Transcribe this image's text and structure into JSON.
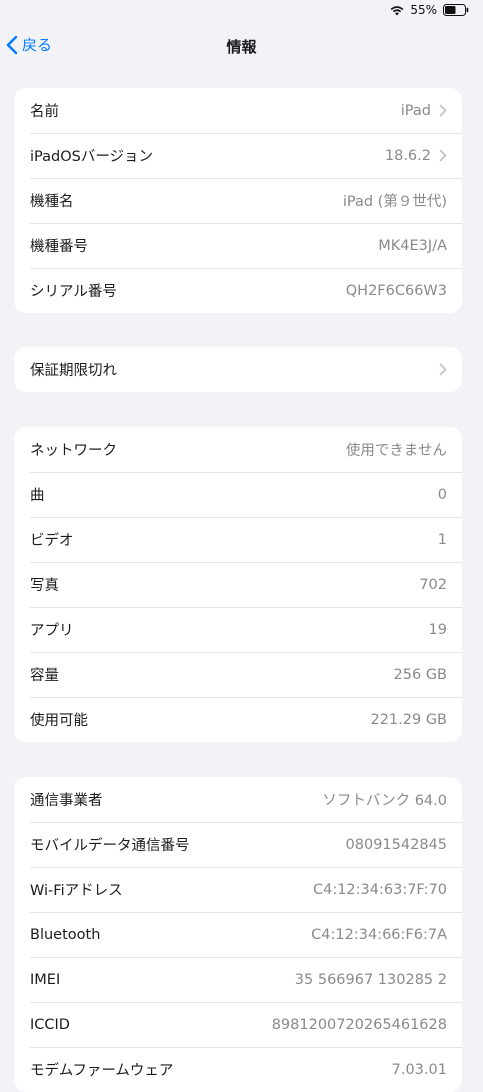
{
  "status_bar": {
    "battery_percent": "55%",
    "battery_level": 0.55,
    "icons": [
      "wifi-icon",
      "battery-icon"
    ]
  },
  "nav": {
    "back_label": "戻る",
    "title": "情報"
  },
  "colors": {
    "accent": "#007aff",
    "background": "#f2f2f7",
    "card": "#ffffff",
    "secondary_text": "#8a8a8e"
  },
  "groups": {
    "device": [
      {
        "label": "名前",
        "value": "iPad",
        "chevron": true
      },
      {
        "label": "iPadOSバージョン",
        "value": "18.6.2",
        "chevron": true
      },
      {
        "label": "機種名",
        "value": "iPad (第９世代)",
        "chevron": false
      },
      {
        "label": "機種番号",
        "value": "MK4E3J/A",
        "chevron": false
      },
      {
        "label": "シリアル番号",
        "value": "QH2F6C66W3",
        "chevron": false
      }
    ],
    "warranty": [
      {
        "label": "保証期限切れ",
        "value": "",
        "chevron": true
      }
    ],
    "media": [
      {
        "label": "ネットワーク",
        "value": "使用できません",
        "chevron": false
      },
      {
        "label": "曲",
        "value": "0",
        "chevron": false
      },
      {
        "label": "ビデオ",
        "value": "1",
        "chevron": false
      },
      {
        "label": "写真",
        "value": "702",
        "chevron": false
      },
      {
        "label": "アプリ",
        "value": "19",
        "chevron": false
      },
      {
        "label": "容量",
        "value": "256 GB",
        "chevron": false
      },
      {
        "label": "使用可能",
        "value": "221.29 GB",
        "chevron": false
      }
    ],
    "network": [
      {
        "label": "通信事業者",
        "value": "ソフトバンク 64.0",
        "chevron": false
      },
      {
        "label": "モバイルデータ通信番号",
        "value": "08091542845",
        "chevron": false
      },
      {
        "label": "Wi-Fiアドレス",
        "value": "C4:12:34:63:7F:70",
        "chevron": false
      },
      {
        "label": "Bluetooth",
        "value": "C4:12:34:66:F6:7A",
        "chevron": false
      },
      {
        "label": "IMEI",
        "value": "35 566967 130285 2",
        "chevron": false
      },
      {
        "label": "ICCID",
        "value": "8981200720265461628",
        "chevron": false
      },
      {
        "label": "モデムファームウェア",
        "value": "7.03.01",
        "chevron": false
      }
    ]
  }
}
